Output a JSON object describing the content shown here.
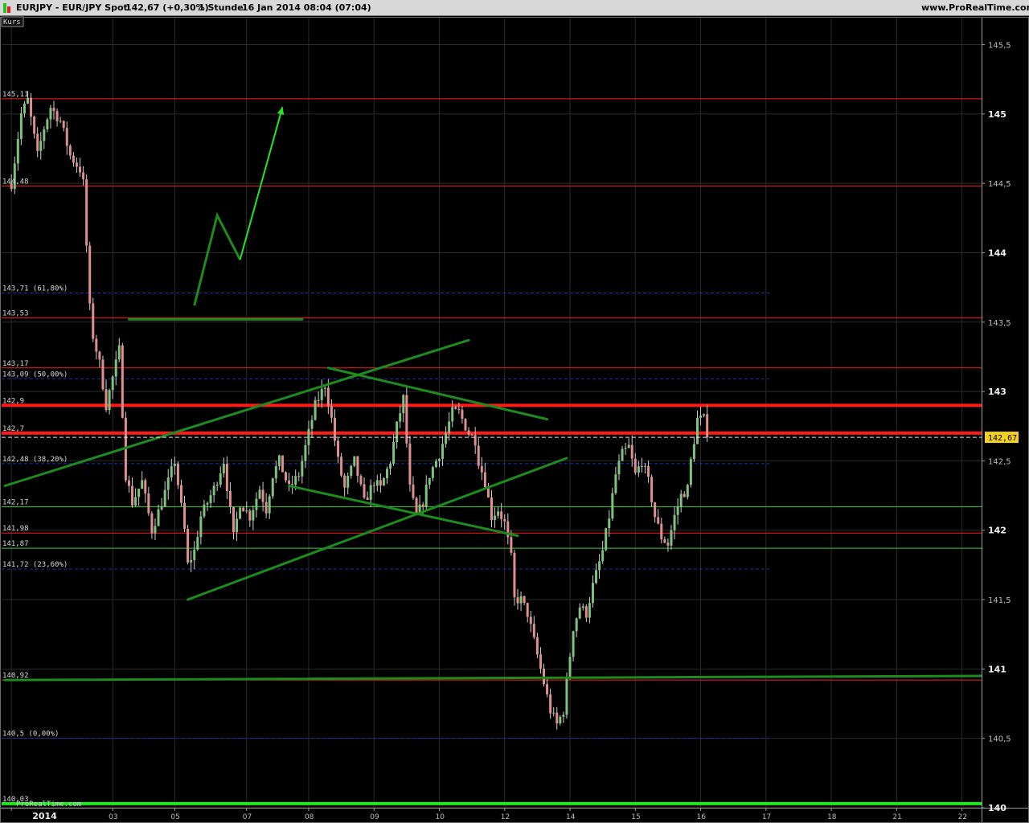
{
  "header": {
    "title": "EURJPY - EUR/JPY Spot",
    "quote": "142,67 (+0,30%)",
    "interval": "1 Stunde",
    "datetime": "16 Jan 2014 08:04 (07:04)",
    "site": "www.ProRealTime.com"
  },
  "panel": {
    "label": "Kurs",
    "watermark": "ProRealTime.com",
    "current_price_tag": "142,67"
  },
  "colors": {
    "background": "#000000",
    "candle_up": "#7fc27f",
    "candle_down": "#e08f8f",
    "resistance": "#ff1a1a",
    "support": "#2ea62e",
    "fib": "#1f2fb0",
    "trend": "#1e8b1e",
    "bright_green": "#22e622",
    "price_tag": "#f5d020"
  },
  "chart_data": {
    "type": "candlestick",
    "title": "EURJPY - EUR/JPY Spot",
    "ylim": [
      140.0,
      145.7
    ],
    "xlim": [
      -3,
      297
    ],
    "grid": true,
    "y_ticks": [
      {
        "value": 145.5,
        "label": "145,5"
      },
      {
        "value": 145.0,
        "label": "145"
      },
      {
        "value": 144.5,
        "label": "144,5"
      },
      {
        "value": 144.0,
        "label": "144"
      },
      {
        "value": 143.5,
        "label": "143,5"
      },
      {
        "value": 143.0,
        "label": "143"
      },
      {
        "value": 142.5,
        "label": "142,5"
      },
      {
        "value": 142.0,
        "label": "142"
      },
      {
        "value": 141.5,
        "label": "141,5"
      },
      {
        "value": 141.0,
        "label": "141"
      },
      {
        "value": 140.5,
        "label": "140,5"
      },
      {
        "value": 140.0,
        "label": "140"
      }
    ],
    "x_ticks": [
      {
        "bar": 0,
        "label": "2014"
      },
      {
        "bar": 31,
        "label": "03"
      },
      {
        "bar": 50,
        "label": "05"
      },
      {
        "bar": 72,
        "label": "07"
      },
      {
        "bar": 91,
        "label": "08"
      },
      {
        "bar": 111,
        "label": "09"
      },
      {
        "bar": 131,
        "label": "10"
      },
      {
        "bar": 151,
        "label": "12"
      },
      {
        "bar": 171,
        "label": "14"
      },
      {
        "bar": 191,
        "label": "15"
      },
      {
        "bar": 211,
        "label": "16"
      },
      {
        "bar": 231,
        "label": "17"
      },
      {
        "bar": 251,
        "label": "18"
      },
      {
        "bar": 271,
        "label": "21"
      },
      {
        "bar": 291,
        "label": "22"
      }
    ],
    "price_path": [
      [
        0,
        144.5
      ],
      [
        3,
        145.0
      ],
      [
        5,
        145.1
      ],
      [
        8,
        144.7
      ],
      [
        10,
        144.9
      ],
      [
        12,
        145.05
      ],
      [
        15,
        144.95
      ],
      [
        18,
        144.7
      ],
      [
        21,
        144.6
      ],
      [
        22,
        144.5
      ],
      [
        24,
        143.6
      ],
      [
        25,
        143.4
      ],
      [
        27,
        143.2
      ],
      [
        29,
        142.9
      ],
      [
        31,
        143.1
      ],
      [
        33,
        143.3
      ],
      [
        35,
        142.4
      ],
      [
        37,
        142.2
      ],
      [
        40,
        142.35
      ],
      [
        43,
        142.0
      ],
      [
        46,
        142.2
      ],
      [
        50,
        142.5
      ],
      [
        53,
        142.0
      ],
      [
        54,
        141.75
      ],
      [
        56,
        141.85
      ],
      [
        58,
        142.1
      ],
      [
        62,
        142.3
      ],
      [
        65,
        142.5
      ],
      [
        68,
        141.95
      ],
      [
        70,
        142.2
      ],
      [
        73,
        142.1
      ],
      [
        76,
        142.3
      ],
      [
        78,
        142.15
      ],
      [
        80,
        142.4
      ],
      [
        82,
        142.5
      ],
      [
        85,
        142.3
      ],
      [
        88,
        142.4
      ],
      [
        90,
        142.6
      ],
      [
        93,
        142.9
      ],
      [
        96,
        143.05
      ],
      [
        98,
        142.8
      ],
      [
        100,
        142.5
      ],
      [
        102,
        142.3
      ],
      [
        105,
        142.5
      ],
      [
        108,
        142.2
      ],
      [
        111,
        142.35
      ],
      [
        113,
        142.3
      ],
      [
        116,
        142.5
      ],
      [
        118,
        142.75
      ],
      [
        120,
        142.95
      ],
      [
        122,
        142.3
      ],
      [
        124,
        142.1
      ],
      [
        126,
        142.2
      ],
      [
        128,
        142.4
      ],
      [
        131,
        142.55
      ],
      [
        133,
        142.7
      ],
      [
        135,
        142.85
      ],
      [
        137,
        142.85
      ],
      [
        140,
        142.7
      ],
      [
        142,
        142.65
      ],
      [
        143,
        142.5
      ],
      [
        145,
        142.35
      ],
      [
        147,
        142.1
      ],
      [
        149,
        142.15
      ],
      [
        151,
        142.05
      ],
      [
        153,
        141.8
      ],
      [
        154,
        141.5
      ],
      [
        156,
        141.5
      ],
      [
        158,
        141.4
      ],
      [
        160,
        141.2
      ],
      [
        161,
        141.1
      ],
      [
        163,
        140.9
      ],
      [
        164,
        140.8
      ],
      [
        165,
        140.7
      ],
      [
        167,
        140.6
      ],
      [
        169,
        140.7
      ],
      [
        170,
        140.9
      ],
      [
        172,
        141.3
      ],
      [
        174,
        141.45
      ],
      [
        176,
        141.4
      ],
      [
        178,
        141.6
      ],
      [
        181,
        141.85
      ],
      [
        183,
        142.1
      ],
      [
        185,
        142.4
      ],
      [
        187,
        142.55
      ],
      [
        189,
        142.6
      ],
      [
        191,
        142.4
      ],
      [
        193,
        142.5
      ],
      [
        195,
        142.35
      ],
      [
        197,
        142.1
      ],
      [
        199,
        141.95
      ],
      [
        201,
        141.9
      ],
      [
        203,
        142.1
      ],
      [
        205,
        142.25
      ],
      [
        207,
        142.3
      ],
      [
        208,
        142.5
      ],
      [
        210,
        142.8
      ],
      [
        212,
        142.8
      ],
      [
        213,
        142.67
      ]
    ],
    "horizontal_levels": [
      {
        "value": 145.11,
        "label": "145,11",
        "kind": "resistance"
      },
      {
        "value": 144.48,
        "label": "144,48",
        "kind": "resistance"
      },
      {
        "value": 143.71,
        "label": "143,71 (61,80%)",
        "kind": "fib"
      },
      {
        "value": 143.53,
        "label": "143,53",
        "kind": "resistance"
      },
      {
        "value": 143.17,
        "label": "143,17",
        "kind": "resistance"
      },
      {
        "value": 143.09,
        "label": "143,09 (50,00%)",
        "kind": "fib"
      },
      {
        "value": 142.9,
        "label": "142,9",
        "kind": "strong-resistance"
      },
      {
        "value": 142.7,
        "label": "142,7",
        "kind": "strong-resistance"
      },
      {
        "value": 142.48,
        "label": "142,48 (38,20%)",
        "kind": "fib"
      },
      {
        "value": 142.17,
        "label": "142,17",
        "kind": "support"
      },
      {
        "value": 141.98,
        "label": "141,98",
        "kind": "resistance"
      },
      {
        "value": 141.87,
        "label": "141,87",
        "kind": "support"
      },
      {
        "value": 141.72,
        "label": "141,72 (23,60%)",
        "kind": "fib"
      },
      {
        "value": 140.92,
        "label": "140,92",
        "kind": "resistance"
      },
      {
        "value": 140.5,
        "label": "140,5 (0,00%)",
        "kind": "fib"
      },
      {
        "value": 140.03,
        "label": "140,03",
        "kind": "strong-support"
      }
    ],
    "trend_lines": [
      {
        "from": [
          -2,
          142.32
        ],
        "to": [
          140,
          143.37
        ],
        "style": "trend"
      },
      {
        "from": [
          54,
          141.5
        ],
        "to": [
          170,
          142.52
        ],
        "style": "trend"
      },
      {
        "from": [
          97,
          143.17
        ],
        "to": [
          164,
          142.8
        ],
        "style": "trend"
      },
      {
        "from": [
          85,
          142.32
        ],
        "to": [
          155,
          141.96
        ],
        "style": "trend"
      },
      {
        "from": [
          36,
          143.52
        ],
        "to": [
          89,
          143.52
        ],
        "style": "trend"
      },
      {
        "from": [
          -2,
          140.92
        ],
        "to": [
          297,
          140.95
        ],
        "style": "trend"
      }
    ],
    "projection_arrow": {
      "points": [
        [
          56,
          143.62
        ],
        [
          63,
          144.27
        ],
        [
          70,
          143.95
        ],
        [
          83,
          145.05
        ]
      ],
      "style": "bright-arrow"
    },
    "current_price": 142.67
  }
}
